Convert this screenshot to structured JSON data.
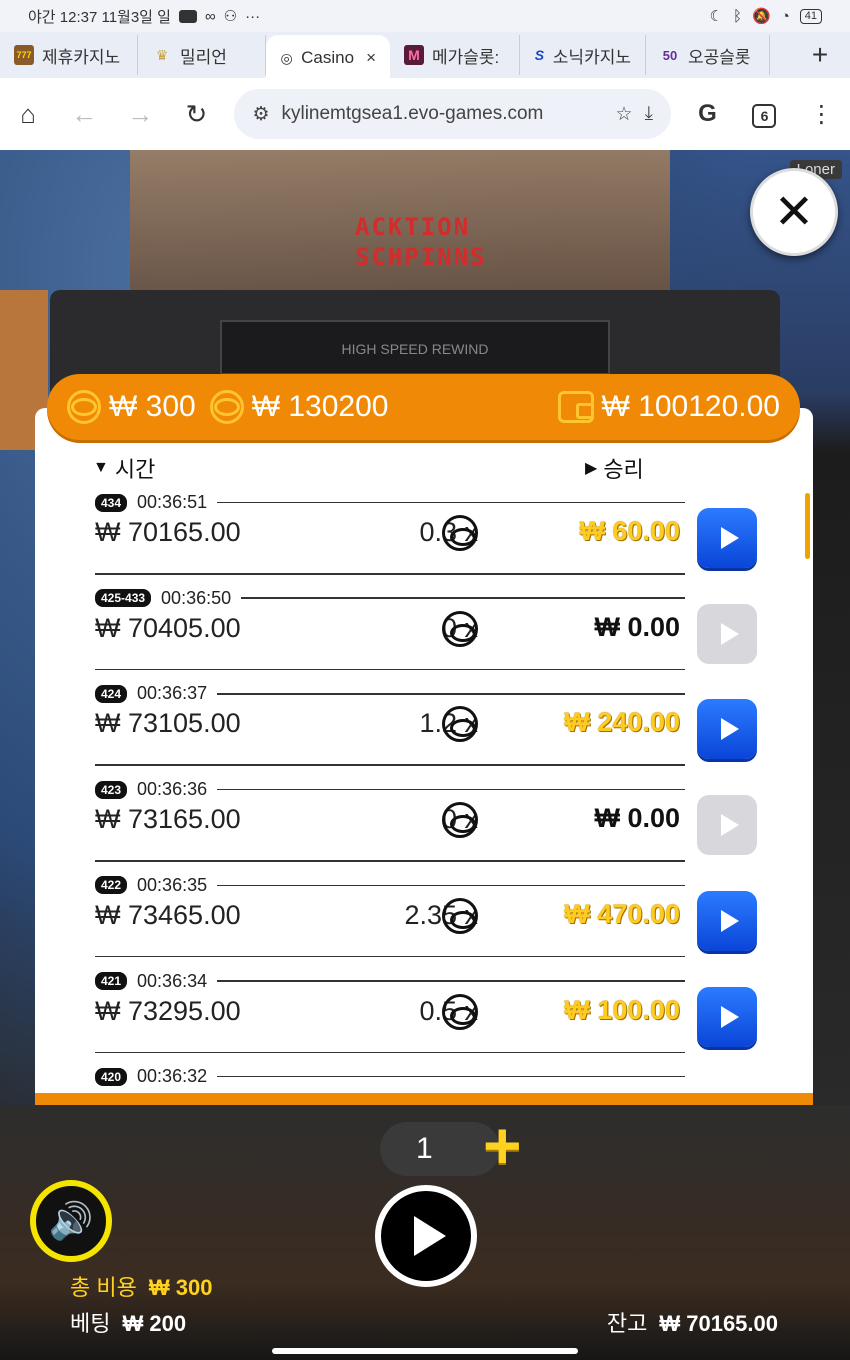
{
  "status": {
    "left_text": "야간 12:37  11월3일 일",
    "right_battery": "41"
  },
  "tabs": [
    {
      "label": "제휴카지노",
      "icon": "777"
    },
    {
      "label": "밀리언",
      "icon": "♛"
    },
    {
      "label": "Casino",
      "icon": "◎",
      "active": true
    },
    {
      "label": "메가슬롯:",
      "icon": "M"
    },
    {
      "label": "소닉카지노",
      "icon": "S"
    },
    {
      "label": "오공슬롯",
      "icon": "50"
    }
  ],
  "browser": {
    "url": "kylinemtgsea1.evo-games.com",
    "tab_count": "6"
  },
  "game": {
    "poster_line1": "ACKTION",
    "poster_line2": "SCHPINNS",
    "vcr_label": "HIGH SPEED REWIND",
    "loner_label": "Loner",
    "header": {
      "cost": "₩ 300",
      "total_win": "₩ 130200",
      "balance": "₩ 100120.00"
    },
    "columns": {
      "time": "시간",
      "win": "승리"
    },
    "rows": [
      {
        "badge": "434",
        "time": "00:36:51",
        "bet": "₩ 70165.00",
        "mult": "0.3 x",
        "win": "₩ 60.00",
        "winning": true
      },
      {
        "badge": "425-433",
        "time": "00:36:50",
        "bet": "₩ 70405.00",
        "mult": "0 x",
        "win": "₩ 0.00",
        "winning": false
      },
      {
        "badge": "424",
        "time": "00:36:37",
        "bet": "₩ 73105.00",
        "mult": "1.2 x",
        "win": "₩ 240.00",
        "winning": true
      },
      {
        "badge": "423",
        "time": "00:36:36",
        "bet": "₩ 73165.00",
        "mult": "0 x",
        "win": "₩ 0.00",
        "winning": false
      },
      {
        "badge": "422",
        "time": "00:36:35",
        "bet": "₩ 73465.00",
        "mult": "2.35 x",
        "win": "₩ 470.00",
        "winning": true
      },
      {
        "badge": "421",
        "time": "00:36:34",
        "bet": "₩ 73295.00",
        "mult": "0.5 x",
        "win": "₩ 100.00",
        "winning": true
      },
      {
        "badge": "420",
        "time": "00:36:32",
        "bet": "",
        "mult": "",
        "win": "",
        "winning": true
      }
    ],
    "counter": "1",
    "footer": {
      "total_cost_label": "총 비용",
      "total_cost": "₩ 300",
      "bet_label": "베팅",
      "bet": "₩ 200",
      "balance_label": "잔고",
      "balance": "₩ 70165.00"
    }
  }
}
